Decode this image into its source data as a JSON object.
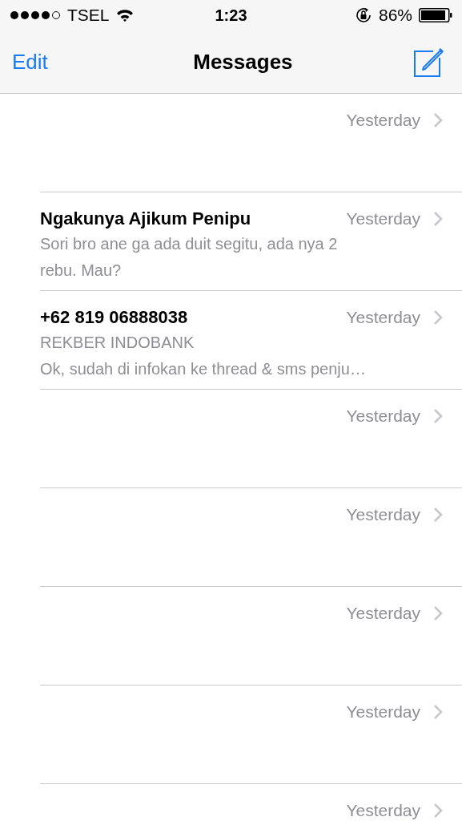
{
  "status_bar": {
    "carrier": "TSEL",
    "time": "1:23",
    "battery": "86%"
  },
  "nav_bar": {
    "left_button": "Edit",
    "title": "Messages"
  },
  "conversations": [
    {
      "time": "Yesterday"
    },
    {
      "name": "Ngakunya Ajikum Penipu",
      "time": "Yesterday",
      "preview_lines": [
        "Sori bro ane ga ada duit segitu, ada nya 2",
        "rebu. Mau?"
      ]
    },
    {
      "name": "+62 819 06888038",
      "time": "Yesterday",
      "preview_lines": [
        "REKBER INDOBANK",
        "Ok, sudah di infokan ke thread & sms penju…"
      ]
    },
    {
      "time": "Yesterday"
    },
    {
      "time": "Yesterday"
    },
    {
      "time": "Yesterday"
    },
    {
      "time": "Yesterday"
    },
    {
      "time": "Yesterday"
    }
  ]
}
